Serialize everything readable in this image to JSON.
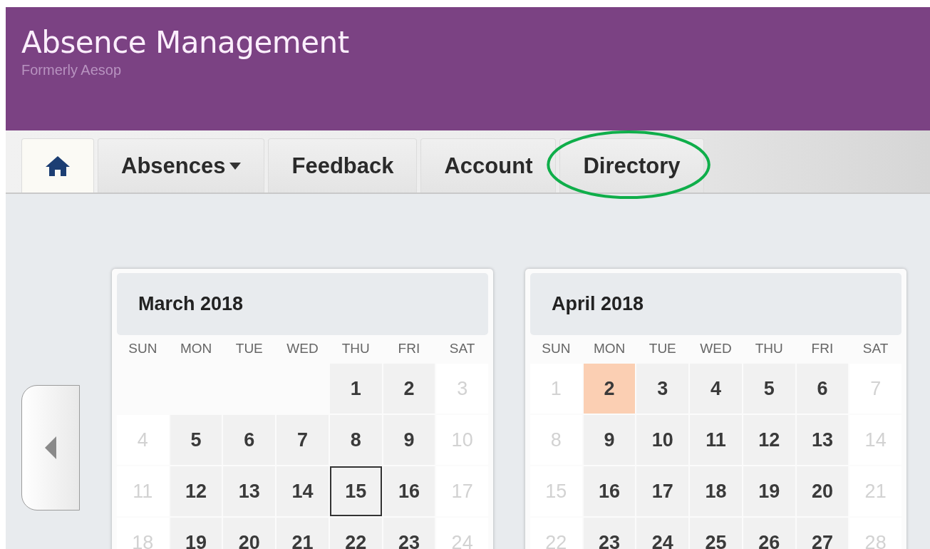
{
  "header": {
    "title": "Absence Management",
    "subtitle": "Formerly Aesop"
  },
  "tabs": [
    {
      "kind": "home",
      "selected": true
    },
    {
      "kind": "text",
      "label": "Absences",
      "dropdown": true,
      "selected": false
    },
    {
      "kind": "text",
      "label": "Feedback",
      "selected": false
    },
    {
      "kind": "text",
      "label": "Account",
      "selected": false
    },
    {
      "kind": "text",
      "label": "Directory",
      "selected": false,
      "circled": true
    }
  ],
  "calendars": [
    {
      "title": "March 2018",
      "weekdays": [
        "SUN",
        "MON",
        "TUE",
        "WED",
        "THU",
        "FRI",
        "SAT"
      ],
      "weeks": [
        [
          {
            "kind": "blank"
          },
          {
            "kind": "blank"
          },
          {
            "kind": "blank"
          },
          {
            "kind": "blank"
          },
          {
            "kind": "weekday",
            "day": "1"
          },
          {
            "kind": "weekday",
            "day": "2"
          },
          {
            "kind": "weekend",
            "day": "3"
          }
        ],
        [
          {
            "kind": "weekend",
            "day": "4"
          },
          {
            "kind": "weekday",
            "day": "5"
          },
          {
            "kind": "weekday",
            "day": "6"
          },
          {
            "kind": "weekday",
            "day": "7"
          },
          {
            "kind": "weekday",
            "day": "8"
          },
          {
            "kind": "weekday",
            "day": "9"
          },
          {
            "kind": "weekend",
            "day": "10"
          }
        ],
        [
          {
            "kind": "weekend",
            "day": "11"
          },
          {
            "kind": "weekday",
            "day": "12"
          },
          {
            "kind": "weekday",
            "day": "13"
          },
          {
            "kind": "weekday",
            "day": "14"
          },
          {
            "kind": "today",
            "day": "15"
          },
          {
            "kind": "weekday",
            "day": "16"
          },
          {
            "kind": "weekend",
            "day": "17"
          }
        ],
        [
          {
            "kind": "weekend",
            "day": "18"
          },
          {
            "kind": "weekday",
            "day": "19"
          },
          {
            "kind": "weekday",
            "day": "20"
          },
          {
            "kind": "weekday",
            "day": "21"
          },
          {
            "kind": "weekday",
            "day": "22"
          },
          {
            "kind": "weekday",
            "day": "23"
          },
          {
            "kind": "weekend",
            "day": "24"
          }
        ]
      ]
    },
    {
      "title": "April 2018",
      "weekdays": [
        "SUN",
        "MON",
        "TUE",
        "WED",
        "THU",
        "FRI",
        "SAT"
      ],
      "weeks": [
        [
          {
            "kind": "weekend",
            "day": "1"
          },
          {
            "kind": "absence",
            "day": "2"
          },
          {
            "kind": "weekday",
            "day": "3"
          },
          {
            "kind": "weekday",
            "day": "4"
          },
          {
            "kind": "weekday",
            "day": "5"
          },
          {
            "kind": "weekday",
            "day": "6"
          },
          {
            "kind": "weekend",
            "day": "7"
          }
        ],
        [
          {
            "kind": "weekend",
            "day": "8"
          },
          {
            "kind": "weekday",
            "day": "9"
          },
          {
            "kind": "weekday",
            "day": "10"
          },
          {
            "kind": "weekday",
            "day": "11"
          },
          {
            "kind": "weekday",
            "day": "12"
          },
          {
            "kind": "weekday",
            "day": "13"
          },
          {
            "kind": "weekend",
            "day": "14"
          }
        ],
        [
          {
            "kind": "weekend",
            "day": "15"
          },
          {
            "kind": "weekday",
            "day": "16"
          },
          {
            "kind": "weekday",
            "day": "17"
          },
          {
            "kind": "weekday",
            "day": "18"
          },
          {
            "kind": "weekday",
            "day": "19"
          },
          {
            "kind": "weekday",
            "day": "20"
          },
          {
            "kind": "weekend",
            "day": "21"
          }
        ],
        [
          {
            "kind": "weekend",
            "day": "22"
          },
          {
            "kind": "weekday",
            "day": "23"
          },
          {
            "kind": "weekday",
            "day": "24"
          },
          {
            "kind": "weekday",
            "day": "25"
          },
          {
            "kind": "weekday",
            "day": "26"
          },
          {
            "kind": "weekday",
            "day": "27"
          },
          {
            "kind": "weekend",
            "day": "28"
          }
        ]
      ]
    }
  ]
}
